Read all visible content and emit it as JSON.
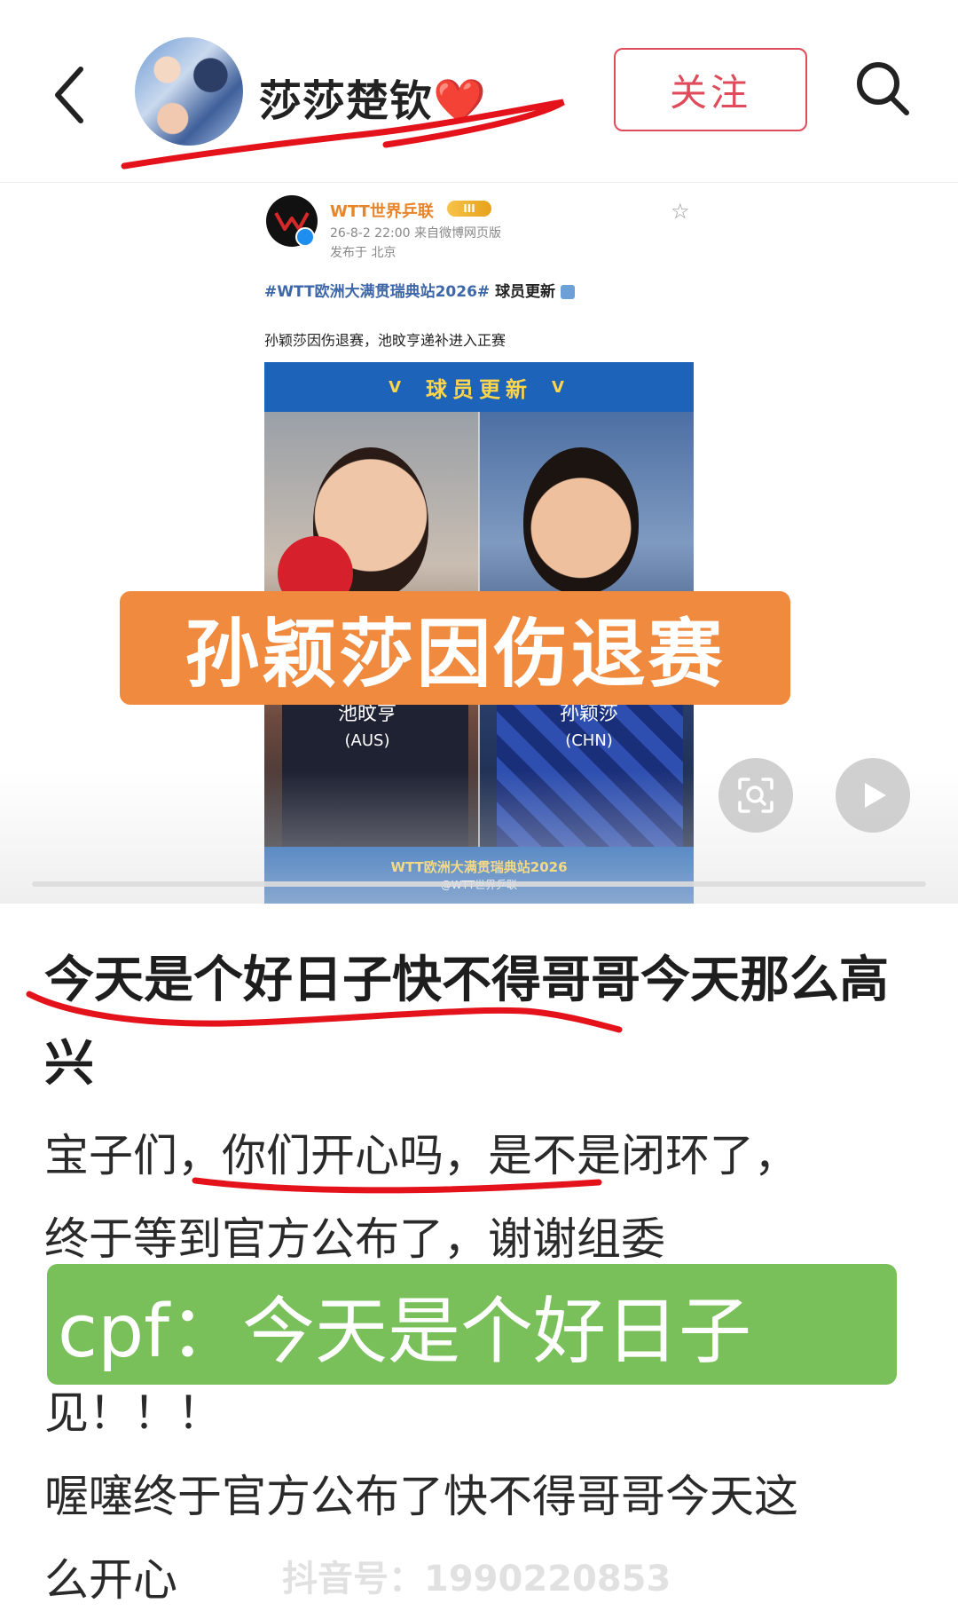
{
  "header": {
    "nickname": "莎莎楚钦❤️",
    "follow_label": "关注",
    "avatar_icon": "user-avatar",
    "back_icon": "chevron-left-icon",
    "search_icon": "search-icon"
  },
  "post": {
    "account": "WTT世界乒联",
    "vip_badge": "III",
    "time_source": "26-8-2 22:00  来自微博网页版",
    "location": "发布于 北京",
    "hashtag": "#WTT欧洲大满贯瑞典站2026#",
    "hashtag_suffix": "球员更新",
    "text": "孙颖莎因伤退赛，池旼亨递补进入正赛",
    "card": {
      "header": "球员更新",
      "left_name": "池旼亨",
      "left_country": "(AUS)",
      "right_name": "孙颖莎",
      "right_country": "(CHN)",
      "footer_title": "WTT欧洲大满贯瑞典站2026",
      "footer_credit": "@WTT世界乒联"
    }
  },
  "overlay_orange": "孙颖莎因伤退赛",
  "content": {
    "title": "今天是个好日子快不得哥哥今天那么高兴",
    "line1": "宝子们，你们开心吗，是不是闭环了，",
    "line2": "终于等到官方公布了，谢谢组委",
    "overlay_green": "cpf：今天是个好日子",
    "line3": "见！！！",
    "line4": "喔噻终于官方公布了快不得哥哥今天这",
    "line5": "么开心"
  },
  "watermark": "抖音号：1990220853",
  "colors": {
    "follow": "#e04b5b",
    "orange_overlay": "#f08a3e",
    "green_overlay": "#79bf5a",
    "wtt_name": "#e8852a",
    "hashtag": "#3d67a8"
  }
}
